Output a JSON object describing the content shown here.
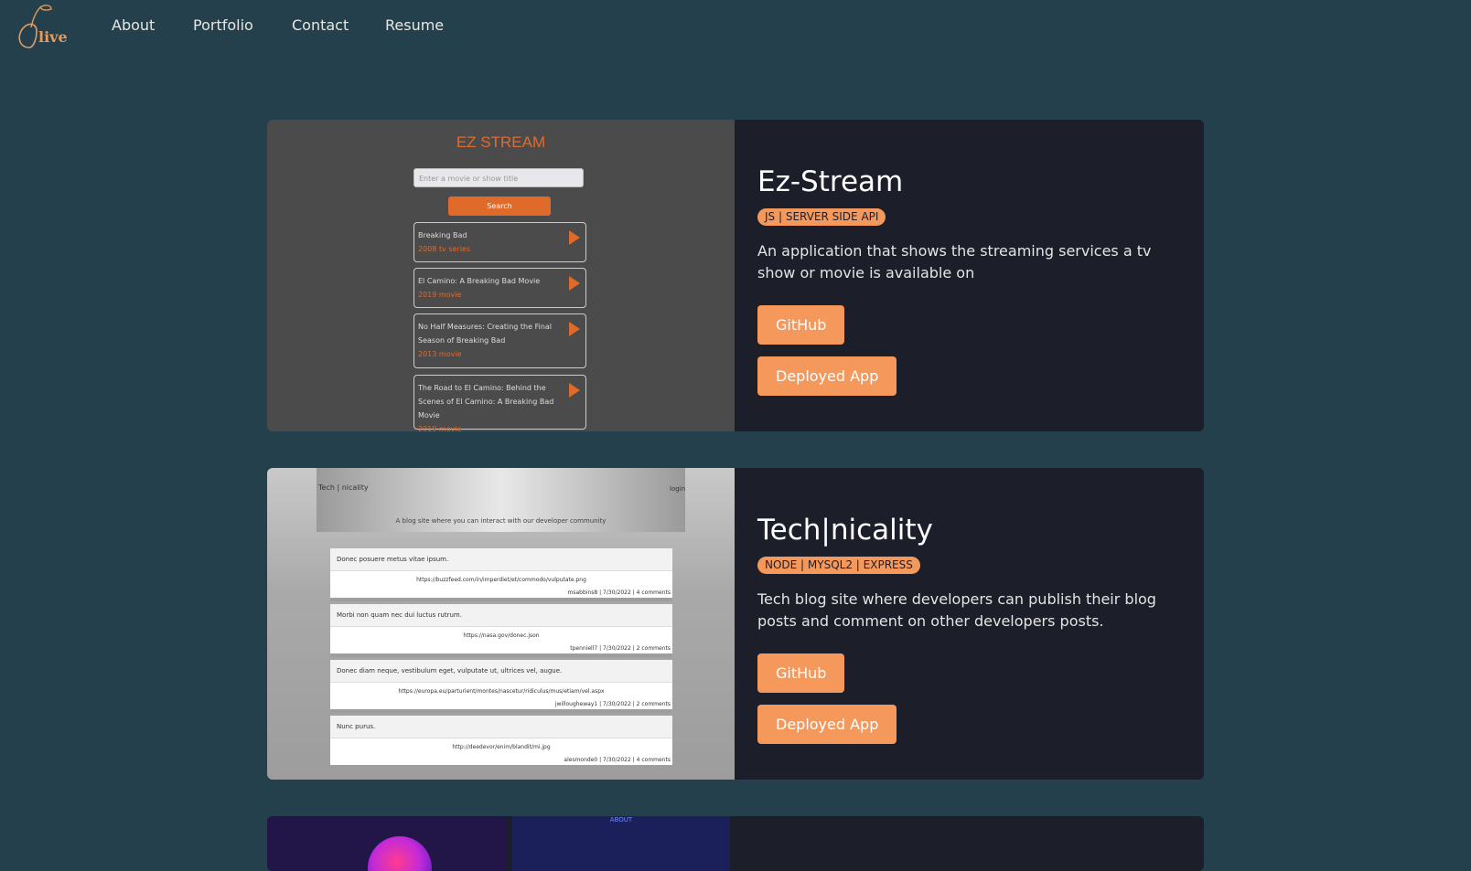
{
  "nav": {
    "logo_text": "Olive",
    "links": [
      "About",
      "Portfolio",
      "Contact",
      "Resume"
    ]
  },
  "projects": [
    {
      "title": "Ez-Stream",
      "tag": "JS | SERVER SIDE API",
      "description": "An application that shows the streaming services a tv show or movie is available on",
      "github_label": "GitHub",
      "deploy_label": "Deployed App",
      "preview": {
        "title": "EZ STREAM",
        "input_placeholder": "Enter a movie or show title",
        "search_label": "Search",
        "results": [
          {
            "title": "Breaking Bad",
            "sub": "2008 tv series"
          },
          {
            "title": "El Camino: A Breaking Bad Movie",
            "sub": "2019 movie"
          },
          {
            "title": "No Half Measures: Creating the Final Season of Breaking Bad",
            "sub": "2013 movie"
          },
          {
            "title": "The Road to El Camino: Behind the Scenes of El Camino: A Breaking Bad Movie",
            "sub": "2019 movie"
          }
        ]
      }
    },
    {
      "title": "Tech|nicality",
      "tag": "NODE | MYSQL2 | EXPRESS",
      "description": "Tech blog site where developers can publish their blog posts and comment on other developers posts.",
      "github_label": "GitHub",
      "deploy_label": "Deployed App",
      "preview": {
        "brand": "Tech | nicality",
        "login": "login",
        "tagline": "A blog site where you can interact with our developer community",
        "posts": [
          {
            "title": "Donec posuere metus vitae ipsum.",
            "url": "https://buzzfeed.com/in/imperdiet/et/commodo/vulputate.png",
            "meta": "msabbins8 | 7/30/2022 | 4 comments"
          },
          {
            "title": "Morbi non quam nec dui luctus rutrum.",
            "url": "https://nasa.gov/donec.json",
            "meta": "tpenniell7 | 7/30/2022 | 2 comments"
          },
          {
            "title": "Donec diam neque, vestibulum eget, vulputate ut, ultrices vel, augue.",
            "url": "https://europa.eu/parturient/montes/nascetur/ridiculus/mus/etiam/vel.aspx",
            "meta": "jwillougheway1 | 7/30/2022 | 2 comments"
          },
          {
            "title": "Nunc purus.",
            "url": "http://deedevor/enim/blandit/mi.jpg",
            "meta": "alesmonde0 | 7/30/2022 | 4 comments"
          }
        ]
      }
    },
    {
      "preview": {
        "about": "ABOUT"
      }
    }
  ]
}
